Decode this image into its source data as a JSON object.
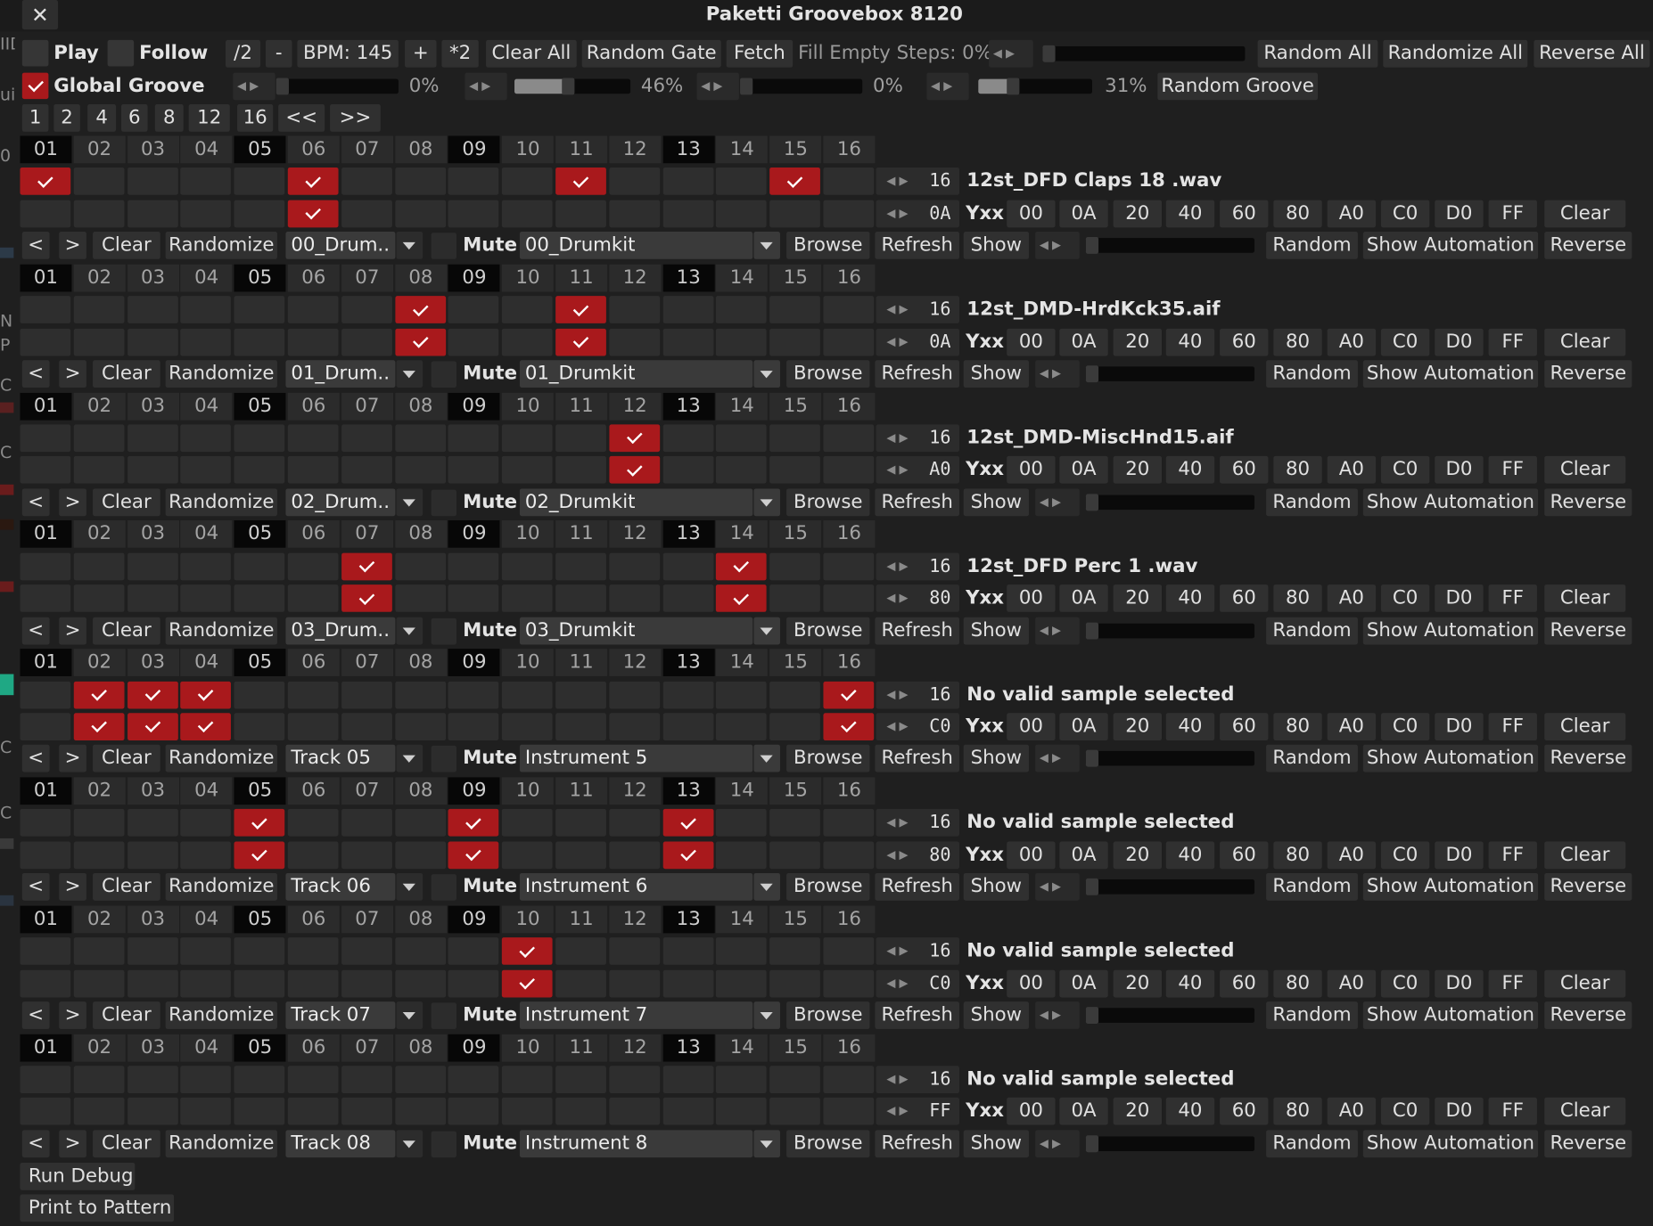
{
  "window": {
    "title": "Paketti Groovebox 8120",
    "close_glyph": "✕"
  },
  "side_fragments": [
    "IID",
    "ui",
    "0",
    "N",
    "P",
    "C",
    "C",
    "C",
    "C"
  ],
  "top": {
    "play": "Play",
    "follow": "Follow",
    "div2": "/2",
    "minus": "-",
    "bpm": "BPM: 145",
    "plus": "+",
    "times2": "*2",
    "clear_all": "Clear All",
    "random_gate": "Random Gate",
    "fetch": "Fetch",
    "fill_empty": "Fill Empty Steps: 0%",
    "random_all": "Random All",
    "randomize_all": "Randomize All",
    "reverse_all": "Reverse All"
  },
  "groove": {
    "label": "Global Groove",
    "enabled": true,
    "sliders": [
      {
        "value_text": "0%",
        "value": 0
      },
      {
        "value_text": "46%",
        "value": 0.46
      },
      {
        "value_text": "0%",
        "value": 0
      },
      {
        "value_text": "31%",
        "value": 0.31
      }
    ],
    "random_groove": "Random Groove"
  },
  "step_buttons": [
    "1",
    "2",
    "4",
    "6",
    "8",
    "12",
    "16",
    "<<",
    ">>"
  ],
  "step_numbers": [
    "01",
    "02",
    "03",
    "04",
    "05",
    "06",
    "07",
    "08",
    "09",
    "10",
    "11",
    "12",
    "13",
    "14",
    "15",
    "16"
  ],
  "yxx_values": [
    "00",
    "0A",
    "20",
    "40",
    "60",
    "80",
    "A0",
    "C0",
    "D0",
    "FF"
  ],
  "labels": {
    "yxx": "Yxx",
    "clear": "Clear",
    "prev": "<",
    "next": ">",
    "randomize": "Randomize",
    "mute": "Mute",
    "browse": "Browse",
    "refresh": "Refresh",
    "show": "Show",
    "random": "Random",
    "show_automation": "Show Automation",
    "reverse": "Reverse",
    "arrows": "◀ ▶"
  },
  "tracks": [
    {
      "steps_count": "16",
      "sample": "12st_DFD Claps 18 .wav",
      "yxx": "0A",
      "track_name": "00_Drum..",
      "instrument": "00_Drumkit",
      "row1": [
        1,
        6,
        11,
        15
      ],
      "row2": [
        6
      ]
    },
    {
      "steps_count": "16",
      "sample": "12st_DMD-HrdKck35.aif",
      "yxx": "0A",
      "track_name": "01_Drum..",
      "instrument": "01_Drumkit",
      "row1": [
        8,
        11
      ],
      "row2": [
        8,
        11
      ]
    },
    {
      "steps_count": "16",
      "sample": "12st_DMD-MiscHnd15.aif",
      "yxx": "A0",
      "track_name": "02_Drum..",
      "instrument": "02_Drumkit",
      "row1": [
        12
      ],
      "row2": [
        12
      ]
    },
    {
      "steps_count": "16",
      "sample": "12st_DFD Perc 1 .wav",
      "yxx": "80",
      "track_name": "03_Drum..",
      "instrument": "03_Drumkit",
      "row1": [
        7,
        14
      ],
      "row2": [
        7,
        14
      ]
    },
    {
      "steps_count": "16",
      "sample": "No valid sample selected",
      "yxx": "C0",
      "track_name": "Track 05",
      "instrument": "Instrument 5",
      "row1": [
        2,
        3,
        4,
        16
      ],
      "row2": [
        2,
        3,
        4,
        16
      ]
    },
    {
      "steps_count": "16",
      "sample": "No valid sample selected",
      "yxx": "80",
      "track_name": "Track 06",
      "instrument": "Instrument 6",
      "row1": [
        5,
        9,
        13
      ],
      "row2": [
        5,
        9,
        13
      ]
    },
    {
      "steps_count": "16",
      "sample": "No valid sample selected",
      "yxx": "C0",
      "track_name": "Track 07",
      "instrument": "Instrument 7",
      "row1": [
        10
      ],
      "row2": [
        10
      ]
    },
    {
      "steps_count": "16",
      "sample": "No valid sample selected",
      "yxx": "FF",
      "track_name": "Track 08",
      "instrument": "Instrument 8",
      "row1": [],
      "row2": []
    }
  ],
  "bottom": {
    "run_debug": "Run Debug",
    "print_to_pattern": "Print to Pattern"
  }
}
